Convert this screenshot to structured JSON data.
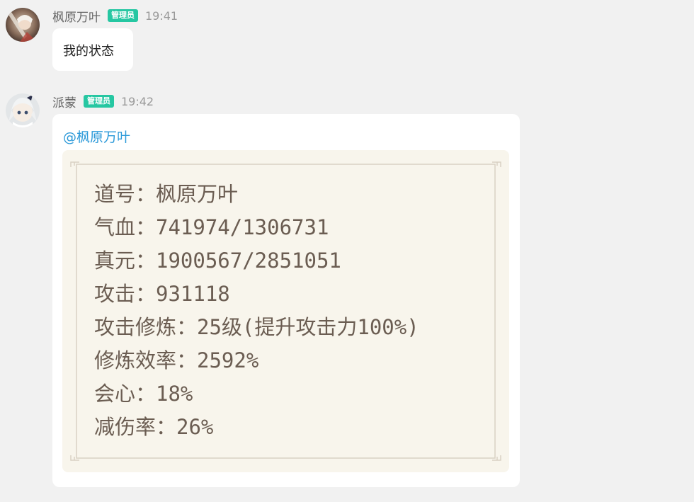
{
  "messages": [
    {
      "sender": "枫原万叶",
      "badge": "管理员",
      "time": "19:41",
      "text": "我的状态"
    },
    {
      "sender": "派蒙",
      "badge": "管理员",
      "time": "19:42",
      "mention": "@枫原万叶",
      "stats": [
        "道号：枫原万叶",
        "气血：741974/1306731",
        "真元：1900567/2851051",
        "攻击：931118",
        "攻击修炼：25级(提升攻击力100%)",
        "修炼效率：2592%",
        "会心：18%",
        "减伤率：26%"
      ]
    }
  ],
  "colors": {
    "background": "#f1f1f1",
    "badge": "#26c7a2",
    "mention": "#2d9ad9",
    "card": "#f8f5ec",
    "stat_text": "#6b5d52"
  },
  "icons": [
    "avatar-kazuha",
    "avatar-paimon"
  ]
}
